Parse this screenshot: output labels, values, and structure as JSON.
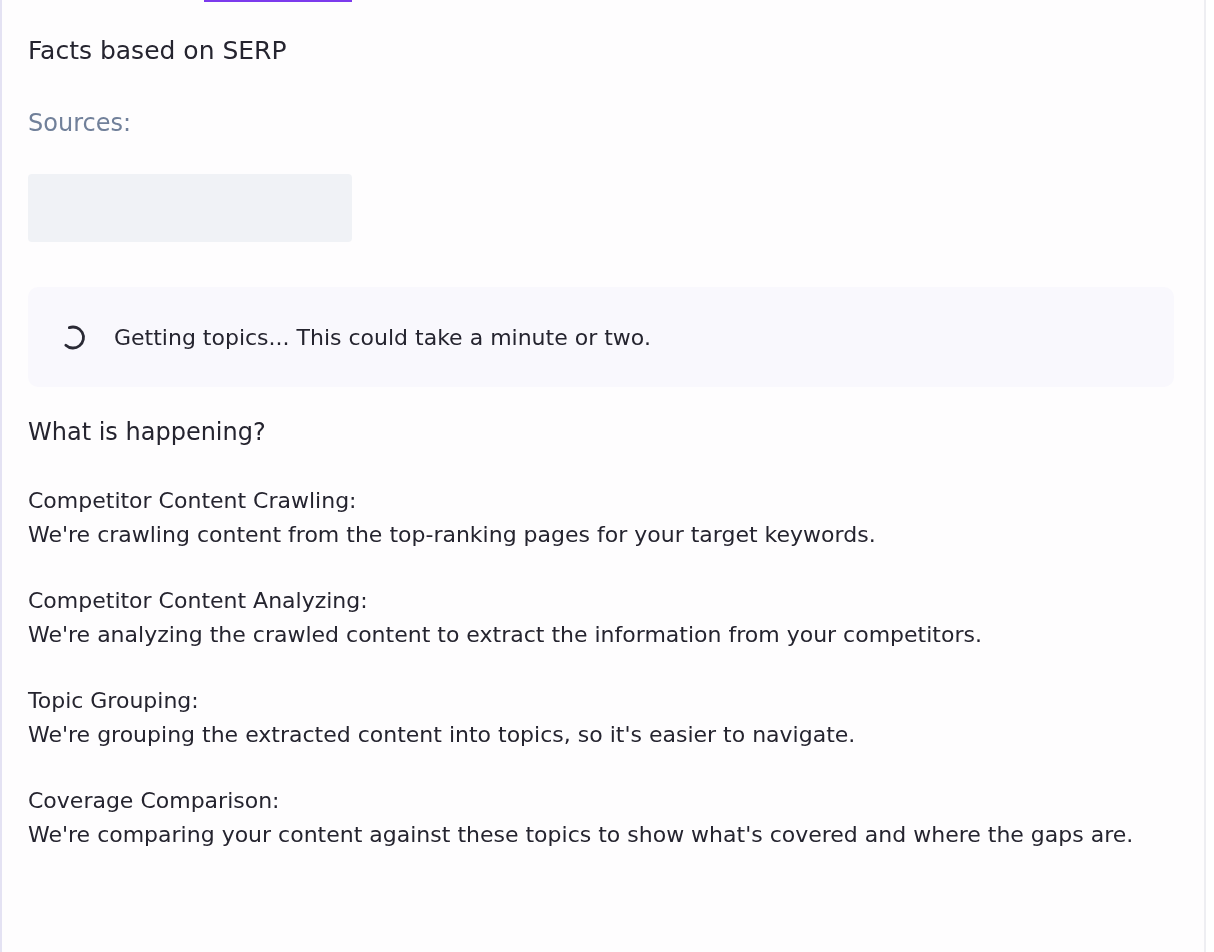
{
  "section_title": "Facts based on SERP",
  "sources_label": "Sources:",
  "sources": {
    "kind": "skeleton"
  },
  "status": {
    "loading": true,
    "message": "Getting topics... This could take a minute or two."
  },
  "explainer": {
    "title": "What is happening?",
    "steps": [
      {
        "title": "Competitor Content Crawling:",
        "description": "We're crawling content from the top-ranking pages for your target keywords."
      },
      {
        "title": "Competitor Content Analyzing:",
        "description": "We're analyzing the crawled content to extract the information from your competitors."
      },
      {
        "title": "Topic Grouping:",
        "description": "We're grouping the extracted content into topics, so it's easier to navigate."
      },
      {
        "title": "Coverage Comparison:",
        "description": "We're comparing your content against these topics to show what's covered and where the gaps are."
      }
    ]
  }
}
